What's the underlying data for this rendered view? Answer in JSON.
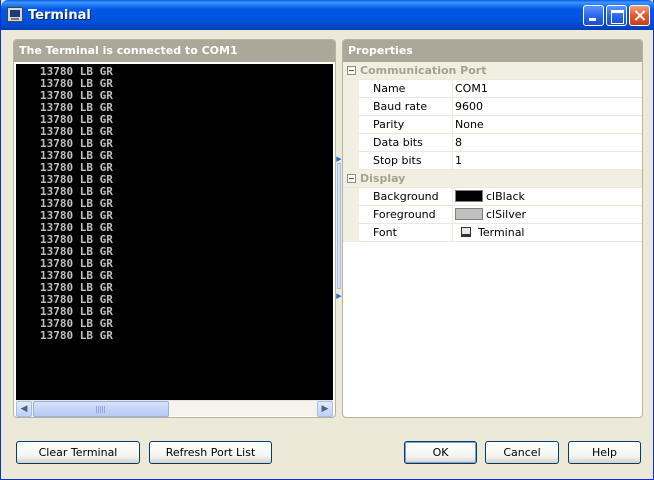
{
  "window": {
    "title": "Terminal"
  },
  "terminal": {
    "header": "The Terminal is connected to COM1",
    "lines": [
      "13780 LB GR",
      "13780 LB GR",
      "13780 LB GR",
      "13780 LB GR",
      "13780 LB GR",
      "13780 LB GR",
      "13780 LB GR",
      "13780 LB GR",
      "13780 LB GR",
      "13780 LB GR",
      "13780 LB GR",
      "13780 LB GR",
      "13780 LB GR",
      "13780 LB GR",
      "13780 LB GR",
      "13780 LB GR",
      "13780 LB GR",
      "13780 LB GR",
      "13780 LB GR",
      "13780 LB GR",
      "13780 LB GR",
      "13780 LB GR",
      "13780 LB GR"
    ],
    "background_color": "#000000",
    "text_color": "#c0c0c0"
  },
  "properties": {
    "header": "Properties",
    "categories": [
      {
        "label": "Communication Port",
        "rows": [
          {
            "name": "Name",
            "value": "COM1"
          },
          {
            "name": "Baud rate",
            "value": "9600"
          },
          {
            "name": "Parity",
            "value": "None"
          },
          {
            "name": "Data bits",
            "value": "8"
          },
          {
            "name": "Stop bits",
            "value": "1"
          }
        ]
      },
      {
        "label": "Display",
        "rows": [
          {
            "name": "Background",
            "value": "clBlack",
            "swatch": "#000000"
          },
          {
            "name": "Foreground",
            "value": "clSilver",
            "swatch": "#c0c0c0"
          },
          {
            "name": "Font",
            "value": "Terminal",
            "icon": "font-icon"
          }
        ]
      }
    ]
  },
  "buttons": {
    "clear_terminal": "Clear Terminal",
    "refresh_port_list": "Refresh Port List",
    "ok": "OK",
    "cancel": "Cancel",
    "help": "Help"
  }
}
